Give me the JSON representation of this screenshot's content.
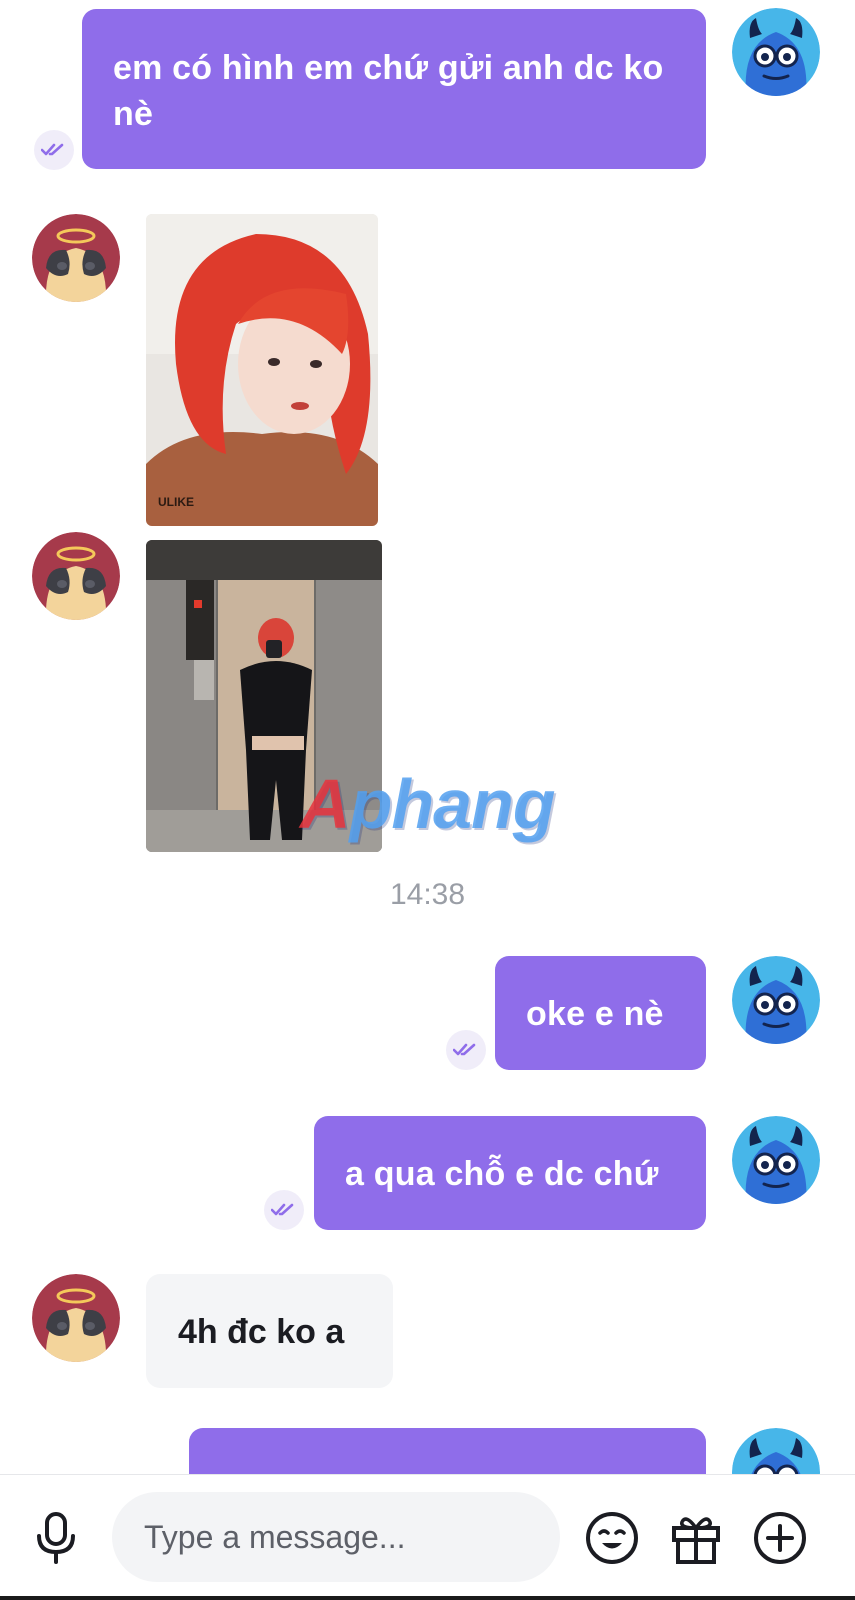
{
  "messages": [
    {
      "direction": "outgoing",
      "type": "text",
      "text": "em có hình em chứ gửi anh dc ko nè",
      "seen": true
    },
    {
      "direction": "incoming",
      "type": "image",
      "alt": "photo-red-hair-portrait"
    },
    {
      "direction": "incoming",
      "type": "image",
      "alt": "photo-elevator-mirror-selfie"
    },
    {
      "direction": "system",
      "type": "timestamp",
      "text": "14:38"
    },
    {
      "direction": "outgoing",
      "type": "text",
      "text": "oke e nè",
      "seen": true
    },
    {
      "direction": "outgoing",
      "type": "text",
      "text": "a qua chỗ e dc chứ",
      "seen": true
    },
    {
      "direction": "incoming",
      "type": "text",
      "text": "4h đc ko a"
    },
    {
      "direction": "outgoing",
      "type": "text",
      "text": "",
      "partially_visible": true
    }
  ],
  "watermark": {
    "first": "A",
    "rest": "phang"
  },
  "composer": {
    "placeholder": "Type a message...",
    "icons": [
      "microphone-icon",
      "emoji-icon",
      "gift-icon",
      "plus-circle-icon"
    ]
  },
  "colors": {
    "outgoing_bubble": "#8f6dea",
    "incoming_bubble": "#f4f5f7",
    "timestamp": "#9a9ea6",
    "seen_check": "#8f6dea"
  }
}
